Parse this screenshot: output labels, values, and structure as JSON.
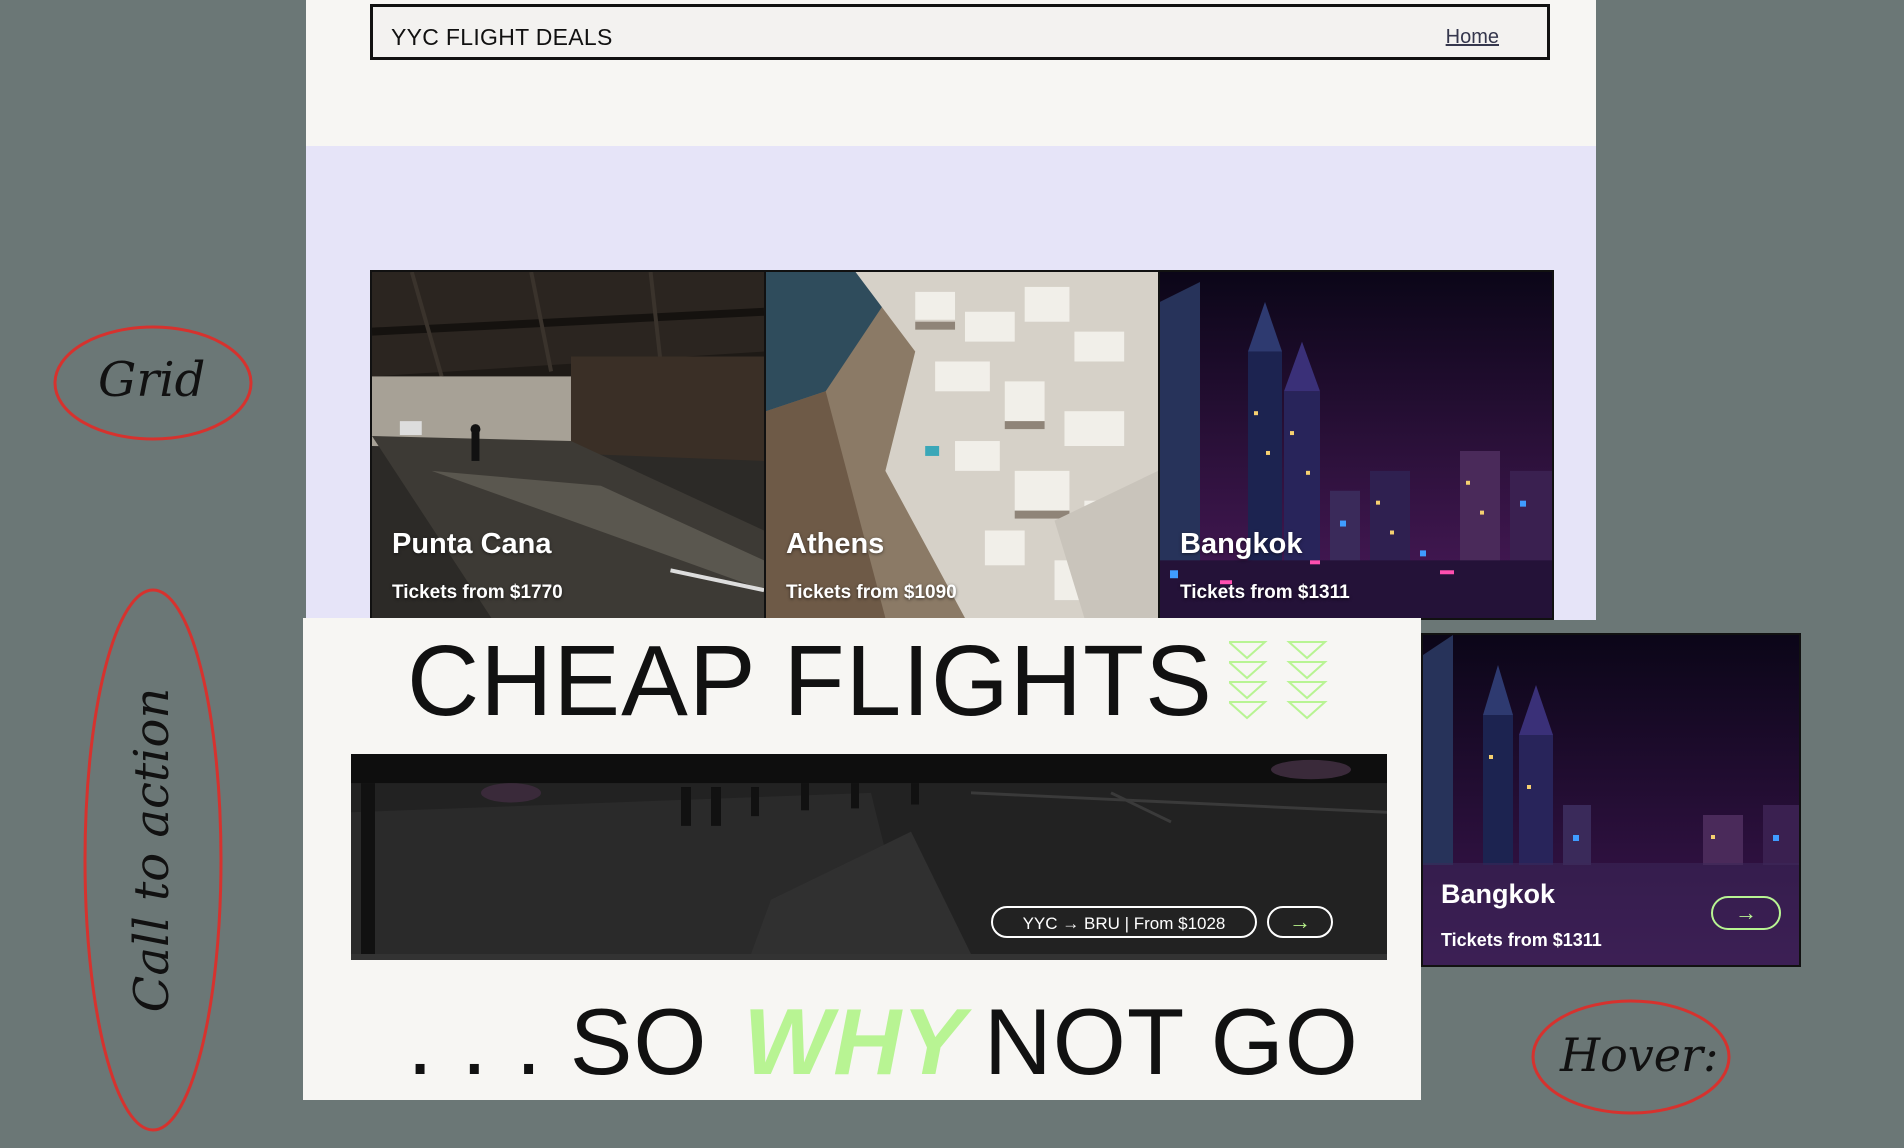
{
  "navbar": {
    "site_title": "YYC FLIGHT DEALS",
    "home_link": "Home"
  },
  "grid_cards": [
    {
      "name": "Punta Cana",
      "price": "Tickets from $1770"
    },
    {
      "name": "Athens",
      "price": "Tickets from $1090"
    },
    {
      "name": "Bangkok",
      "price": "Tickets from $1311"
    }
  ],
  "cta": {
    "title": "CHEAP FLIGHTS",
    "route": "YYC → BRU | From $1028",
    "arrow": "→",
    "footer_prefix": ". . . SO",
    "footer_emphasis": "WHY",
    "footer_suffix": "NOT GO"
  },
  "hover_card": {
    "name": "Bangkok",
    "price": "Tickets from $1311",
    "arrow": "→"
  },
  "annotations": {
    "grid": "Grid",
    "call_to_action": "Call to action",
    "hover": "Hover:"
  },
  "colors": {
    "background": "#6b7776",
    "lavender": "#e6e4f8",
    "accent_green": "#b8f493",
    "annotation_red": "#d6322e"
  }
}
